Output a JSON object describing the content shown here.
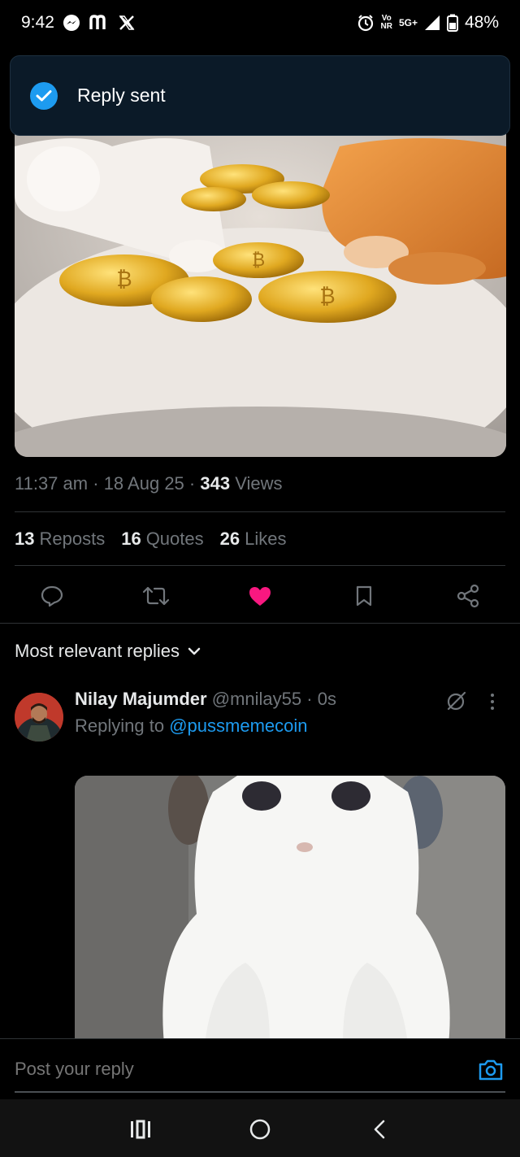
{
  "status_bar": {
    "time": "9:42",
    "carrier_vo": "Vo",
    "carrier_nr": "NR",
    "network": "5G+",
    "battery": "48%"
  },
  "toast": {
    "text": "Reply sent"
  },
  "post": {
    "time": "11:37 am",
    "date": "18 Aug 25",
    "views_count": "343",
    "views_label": "Views",
    "reposts_count": "13",
    "reposts_label": "Reposts",
    "quotes_count": "16",
    "quotes_label": "Quotes",
    "likes_count": "26",
    "likes_label": "Likes"
  },
  "sort": {
    "label": "Most relevant replies"
  },
  "reply": {
    "name": "Nilay Majumder",
    "handle": "@mnilay55",
    "time": "0s",
    "replying_prefix": "Replying to",
    "replying_to": "@pussmemecoin"
  },
  "composer": {
    "placeholder": "Post your reply"
  },
  "colors": {
    "accent": "#1d9bf0",
    "like": "#f91880",
    "background": "#000000"
  }
}
